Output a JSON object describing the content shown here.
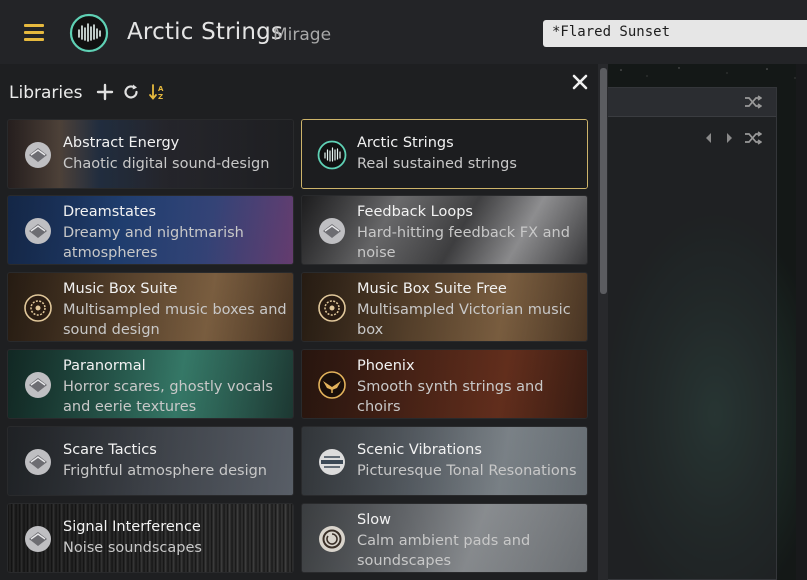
{
  "app": {
    "title": "Arctic Strings",
    "subtitle": "Mirage",
    "preset": "*Flared Sunset"
  },
  "libraries": {
    "heading": "Libraries",
    "toolbar_icons": [
      "plus-icon",
      "refresh-icon",
      "sort-icon"
    ],
    "items": [
      {
        "title": "Abstract Energy",
        "desc": "Chaotic digital sound-design",
        "icon": "emblem-icon",
        "theme": "glitch"
      },
      {
        "title": "Arctic Strings",
        "desc": "Real sustained strings",
        "icon": "arctic-strings-icon",
        "theme": "dark",
        "selected": true
      },
      {
        "title": "Dreamstates",
        "desc": "Dreamy and nightmarish atmospheres",
        "icon": "emblem-icon",
        "theme": "blue"
      },
      {
        "title": "Feedback Loops",
        "desc": "Hard-hitting feedback FX and noise",
        "icon": "emblem-icon",
        "theme": "grey"
      },
      {
        "title": "Music Box Suite",
        "desc": "Multisampled music boxes and sound design",
        "icon": "gear-emblem-icon",
        "theme": "bronze"
      },
      {
        "title": "Music Box Suite Free",
        "desc": "Multisampled Victorian music box",
        "icon": "gear-emblem-icon",
        "theme": "bronze"
      },
      {
        "title": "Paranormal",
        "desc": "Horror scares, ghostly vocals and eerie textures",
        "icon": "emblem-icon",
        "theme": "teal"
      },
      {
        "title": "Phoenix",
        "desc": "Smooth synth strings and choirs",
        "icon": "phoenix-icon",
        "theme": "red"
      },
      {
        "title": "Scare Tactics",
        "desc": "Frightful atmosphere design",
        "icon": "emblem-icon",
        "theme": "slate"
      },
      {
        "title": "Scenic Vibrations",
        "desc": "Picturesque Tonal Resonations",
        "icon": "scenic-icon",
        "theme": "mist"
      },
      {
        "title": "Signal Interference",
        "desc": "Noise soundscapes",
        "icon": "emblem-icon",
        "theme": "noise"
      },
      {
        "title": "Slow",
        "desc": "Calm ambient pads and soundscapes",
        "icon": "slow-icon",
        "theme": "fog"
      }
    ]
  },
  "colors": {
    "accent": "#e6b93e",
    "selected_border": "#cdb46a",
    "panel_bg": "#1e1f21",
    "topbar_bg": "#232427"
  }
}
